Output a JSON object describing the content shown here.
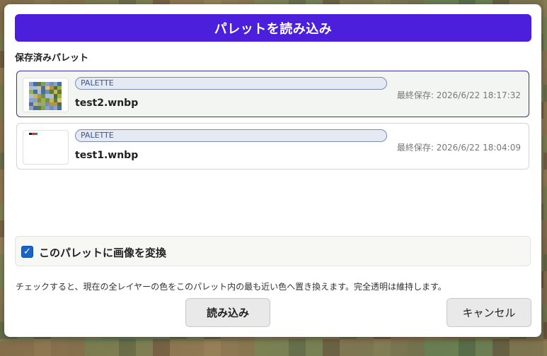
{
  "dialog": {
    "title": "パレットを読み込み",
    "section_label": "保存済みパレット"
  },
  "palettes": [
    {
      "badge": "PALETTE",
      "name": "test2.wnbp",
      "saved_at": "最終保存: 2026/6/22 18:17:32",
      "selected": true
    },
    {
      "badge": "PALETTE",
      "name": "test1.wnbp",
      "saved_at": "最終保存: 2026/6/22 18:04:09",
      "selected": false
    }
  ],
  "convert": {
    "label": "このパレットに画像を変換",
    "checked": true,
    "help": "チェックすると、現在の全レイヤーの色をこのパレット内の最も近い色へ置き換えます。完全透明は維持します。"
  },
  "buttons": {
    "load": "読み込み",
    "cancel": "キャンセル"
  },
  "colors": {
    "accent": "#4b1fdc",
    "selected_border": "#3a2fa8",
    "checkbox": "#1c63c7",
    "badge_text": "#3e5594"
  }
}
